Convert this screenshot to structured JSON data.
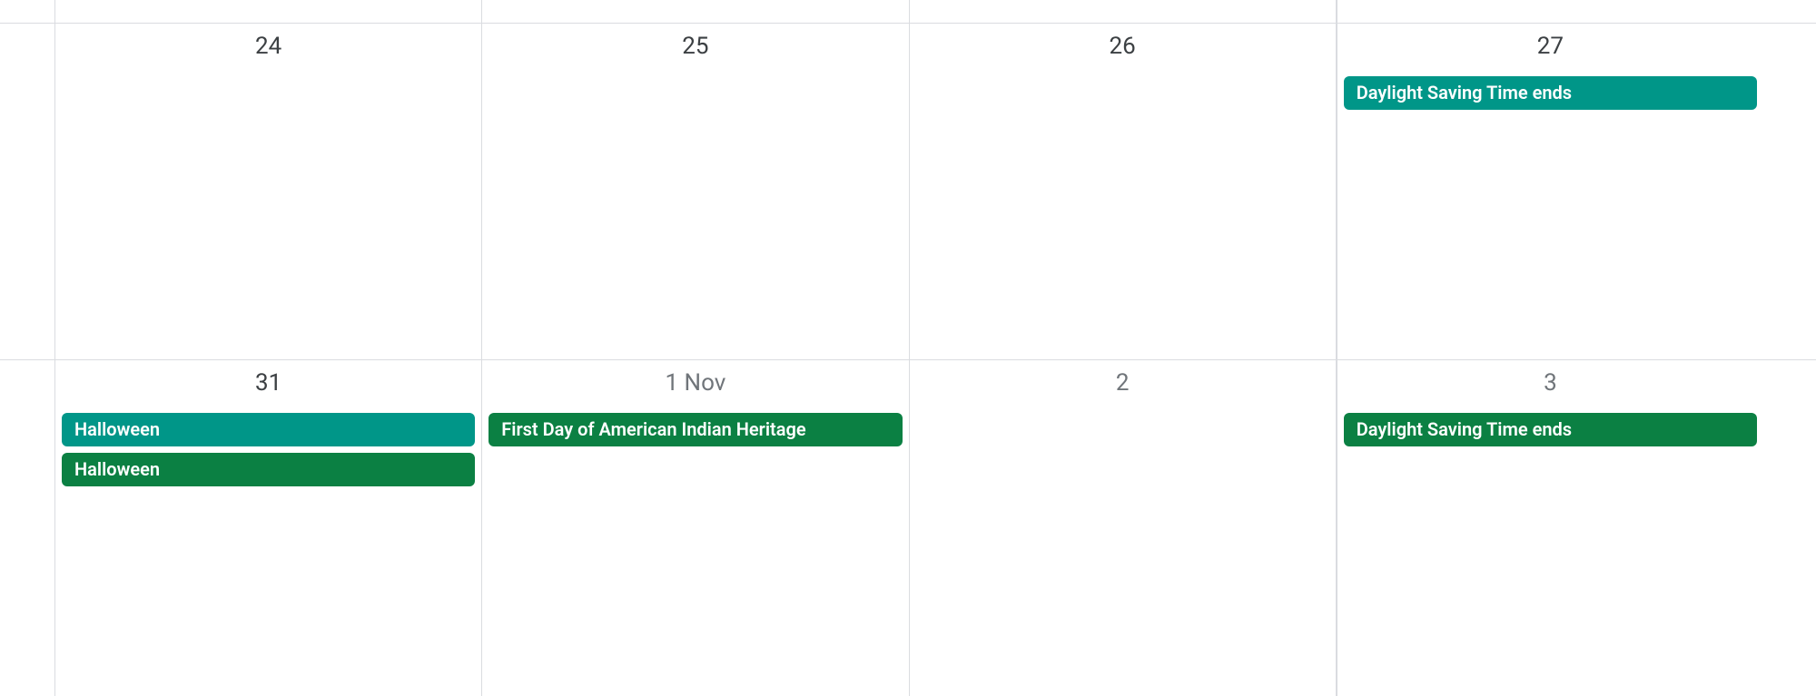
{
  "weeks": [
    {
      "days": [
        {
          "label": "24",
          "dimmed": false,
          "events": []
        },
        {
          "label": "25",
          "dimmed": false,
          "events": []
        },
        {
          "label": "26",
          "dimmed": false,
          "events": []
        },
        {
          "label": "27",
          "dimmed": false,
          "events": [
            {
              "title": "Daylight Saving Time ends",
              "color": "teal"
            }
          ]
        }
      ]
    },
    {
      "days": [
        {
          "label": "31",
          "dimmed": false,
          "events": [
            {
              "title": "Halloween",
              "color": "teal"
            },
            {
              "title": "Halloween",
              "color": "green"
            }
          ]
        },
        {
          "label": "1 Nov",
          "dimmed": true,
          "events": [
            {
              "title": "First Day of American Indian Heritage",
              "color": "green"
            }
          ]
        },
        {
          "label": "2",
          "dimmed": true,
          "events": []
        },
        {
          "label": "3",
          "dimmed": true,
          "events": [
            {
              "title": "Daylight Saving Time ends",
              "color": "green"
            }
          ]
        }
      ]
    }
  ]
}
